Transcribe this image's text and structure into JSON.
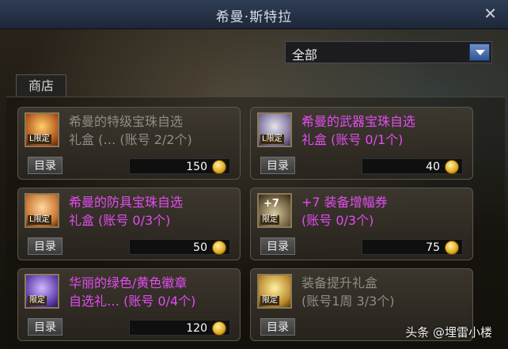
{
  "window": {
    "title": "希曼·斯特拉"
  },
  "filter": {
    "selected": "全部"
  },
  "tabs": {
    "shop": "商店"
  },
  "items": [
    {
      "name": "希曼的特级宝珠自选\n礼盒 (… (账号 2/2个)",
      "badge": "L限定",
      "catalog": "目录",
      "price": "150",
      "name_color": "grey",
      "icon": "gold-box-icon"
    },
    {
      "name": "希曼的武器宝珠自选\n礼盒   (账号 0/1个)",
      "badge": "L限定",
      "catalog": "目录",
      "price": "40",
      "name_color": "purple",
      "icon": "silver-box-icon"
    },
    {
      "name": "希曼的防具宝珠自选\n礼盒 (账号 0/3个)",
      "badge": "L限定",
      "catalog": "目录",
      "price": "50",
      "name_color": "purple",
      "icon": "orange-box-icon"
    },
    {
      "name": "+7 装备增幅券\n  (账号 0/3个)",
      "badge": "限定",
      "catalog": "目录",
      "price": "75",
      "name_color": "purple",
      "icon": "plus7-ticket-icon",
      "icon_text": "+7"
    },
    {
      "name": "华丽的绿色/黄色徽章\n自选礼… (账号 0/4个)",
      "badge": "限定",
      "catalog": "目录",
      "price": "120",
      "name_color": "purple",
      "icon": "purple-box-icon"
    },
    {
      "name": "装备提升礼盒\n  (账号1周 3/3个)",
      "badge": "限定",
      "catalog": "目录",
      "price": "",
      "name_color": "grey",
      "icon": "golden-box-icon"
    }
  ],
  "watermark": "头条 @埋雷小楼",
  "colors": {
    "purple_text": "#e24cf0",
    "grey_text": "#8f8c86",
    "titlebar": "#2f3d55"
  }
}
